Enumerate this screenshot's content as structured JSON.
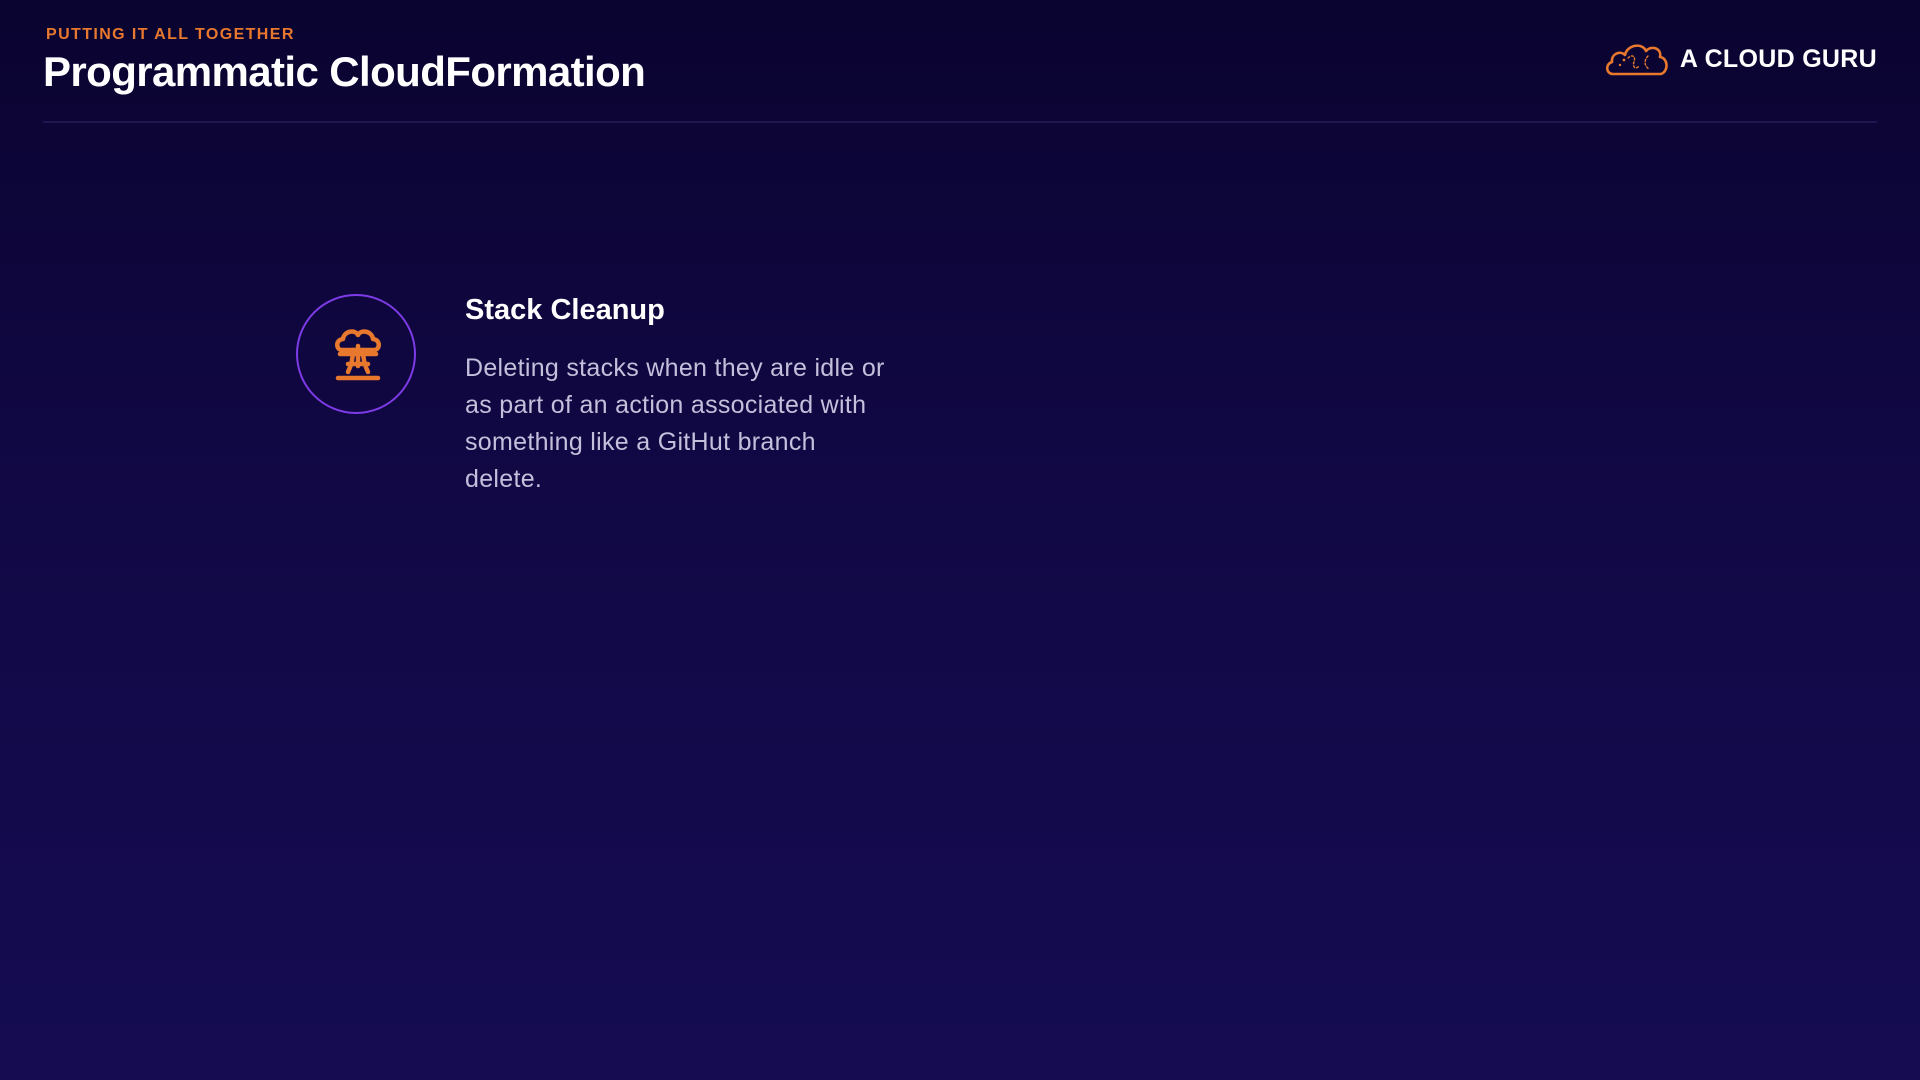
{
  "header": {
    "eyebrow": "PUTTING IT ALL TOGETHER",
    "title": "Programmatic CloudFormation"
  },
  "brand": {
    "icon": "cloud-logo-icon",
    "name": "A CLOUD GURU"
  },
  "feature": {
    "icon": "mushroom-cloud-icon",
    "title": "Stack Cleanup",
    "body": "Deleting stacks when they are idle or as part of an action associated with something like a GitHut branch delete."
  },
  "colors": {
    "accent": "#e7782d",
    "ring": "#7d3be6",
    "background_top": "#0a0430",
    "background_bottom": "#150c52",
    "body_text": "#c4bfdb"
  }
}
